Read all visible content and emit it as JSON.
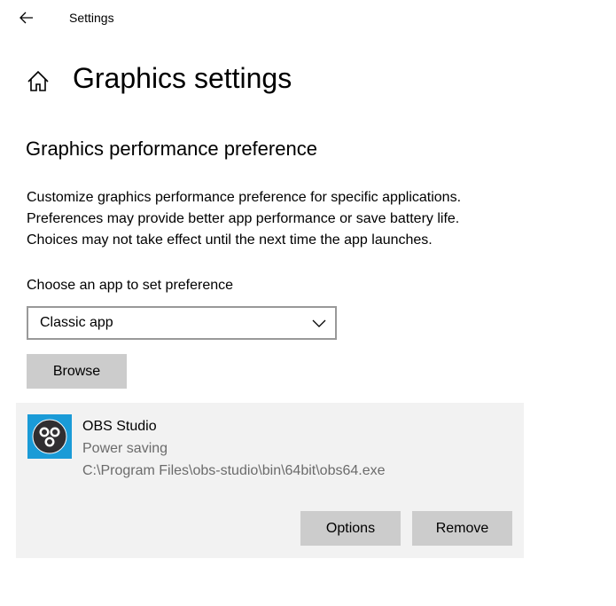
{
  "window": {
    "title": "Settings"
  },
  "page": {
    "title": "Graphics settings",
    "section_title": "Graphics performance preference",
    "description_lines": [
      "Customize graphics performance preference for specific applications.",
      "Preferences may provide better app performance or save battery life.",
      "Choices may not take effect until the next time the app launches."
    ]
  },
  "chooser": {
    "label": "Choose an app to set preference",
    "selected_value": "Classic app",
    "browse_label": "Browse"
  },
  "app_entry": {
    "name": "OBS Studio",
    "preference": "Power saving",
    "path": "C:\\Program Files\\obs-studio\\bin\\64bit\\obs64.exe",
    "icon": "obs-studio-icon",
    "icon_bg_color": "#1a9bd7",
    "options_label": "Options",
    "remove_label": "Remove"
  },
  "colors": {
    "button_bg": "#cccccc",
    "card_bg": "#f2f2f2",
    "secondary_text": "#6b6b6b"
  }
}
